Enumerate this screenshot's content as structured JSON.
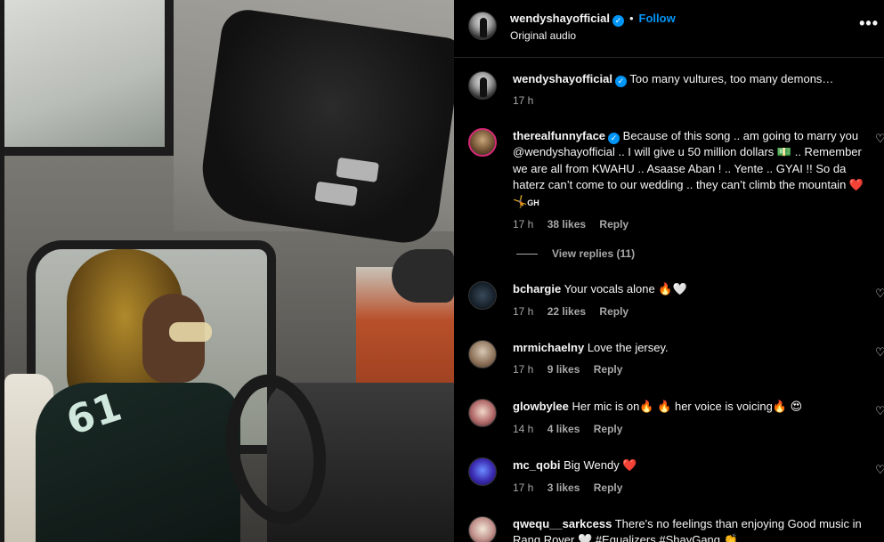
{
  "media": {
    "jersey_number": "61"
  },
  "header": {
    "username": "wendyshayofficial",
    "verified_glyph": "✓",
    "separator": "•",
    "follow_label": "Follow",
    "subtitle": "Original audio",
    "more_label": "•••"
  },
  "caption": {
    "username": "wendyshayofficial",
    "text": "Too many vultures, too many demons…",
    "time": "17 h"
  },
  "comments": [
    {
      "username": "therealfunnyface",
      "verified": true,
      "text_parts": [
        "Because of this song .. am going to marry you @wendyshayofficial .. I will give u 50 million dollars ",
        "💵",
        " .. Remember we are all from KWAHU .. Asaase Aban ! .. Yente .. GYAI !! So da haterz can’t come to our wedding .. they can’t climb the mountain ",
        "❤️",
        " ",
        "🤸",
        "GH"
      ],
      "time": "17 h",
      "likes": "38 likes",
      "reply": "Reply",
      "view_replies": "View replies (11)"
    },
    {
      "username": "bchargie",
      "text": "Your vocals alone",
      "emojis": [
        "🔥",
        "🤍"
      ],
      "time": "17 h",
      "likes": "22 likes",
      "reply": "Reply"
    },
    {
      "username": "mrmichaelny",
      "text": "Love the jersey.",
      "time": "17 h",
      "likes": "9 likes",
      "reply": "Reply"
    },
    {
      "username": "glowbylee",
      "text_a": "Her mic is on",
      "emoji_a": "🔥",
      "emoji_b": "🔥",
      "text_b": "her voice is voicing",
      "emoji_c": "🔥",
      "emoji_d": "😍",
      "time": "14 h",
      "likes": "4 likes",
      "reply": "Reply"
    },
    {
      "username": "mc_qobi",
      "text": "Big Wendy",
      "emoji": "❤️",
      "time": "17 h",
      "likes": "3 likes",
      "reply": "Reply"
    },
    {
      "username": "qwequ__sarkcess",
      "text": "There's no feelings than enjoying Good music in Rang Rover",
      "emoji": "🤍",
      "tail": "#Equalizers #ShayGang",
      "tail_emoji": "👏"
    }
  ],
  "icons": {
    "heart": "♡",
    "verified": "verified-badge-icon",
    "more": "more-options-icon"
  },
  "colors": {
    "background": "#000000",
    "text": "#f5f5f5",
    "secondary": "#a8a8a8",
    "link": "#0095f6",
    "divider": "#262626",
    "heart_red": "#ff3040"
  }
}
